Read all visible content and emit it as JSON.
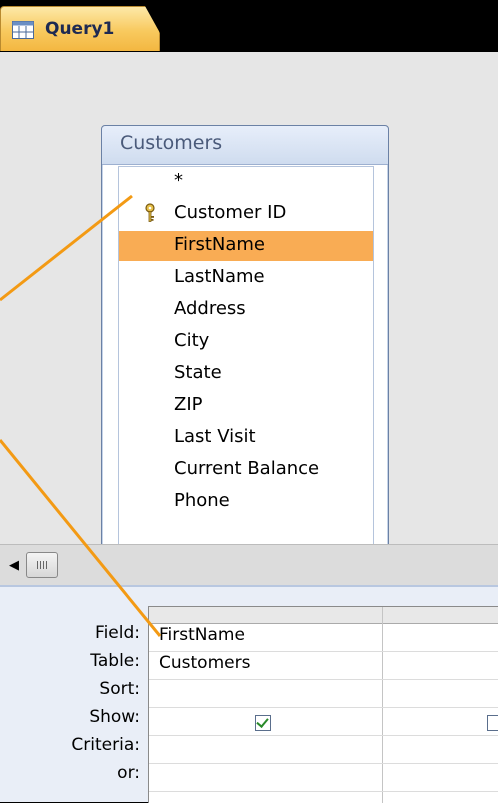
{
  "tab": {
    "title": "Query1",
    "icon": "query-icon"
  },
  "table": {
    "name": "Customers",
    "fields": [
      "*",
      "Customer ID",
      "FirstName",
      "LastName",
      "Address",
      "City",
      "State",
      "ZIP",
      "Last Visit",
      "Current Balance",
      "Phone"
    ],
    "primary_key_field": "Customer ID",
    "selected_field": "FirstName"
  },
  "grid": {
    "row_labels": [
      "Field:",
      "Table:",
      "Sort:",
      "Show:",
      "Criteria:",
      "or:"
    ],
    "columns": [
      {
        "field": "FirstName",
        "table": "Customers",
        "sort": "",
        "show": true,
        "criteria": "",
        "or": ""
      },
      {
        "field": "",
        "table": "",
        "sort": "",
        "show": false,
        "criteria": "",
        "or": ""
      }
    ]
  },
  "colors": {
    "highlight": "#f9ac54",
    "callout_line": "#f39a14",
    "tab": "#f8c95e",
    "background": "#000000"
  }
}
